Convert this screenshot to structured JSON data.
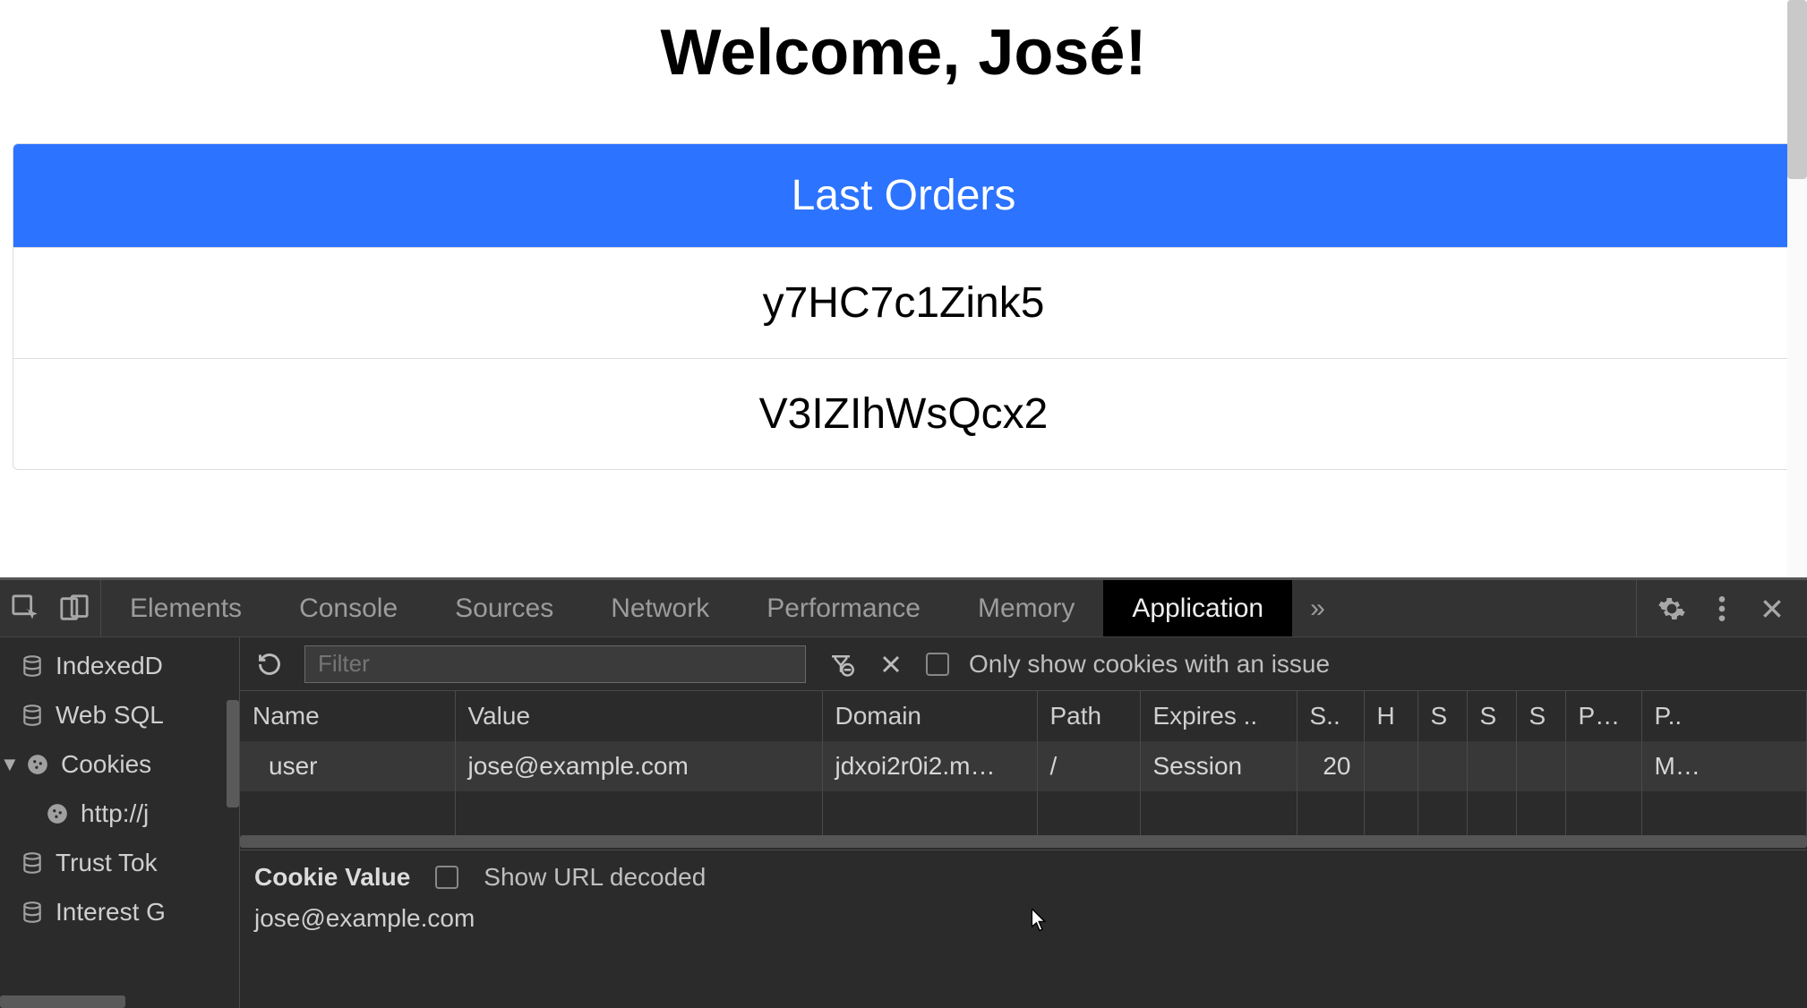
{
  "page": {
    "welcome": "Welcome, José!",
    "last_orders_title": "Last Orders",
    "orders": [
      "y7HC7c1Zink5",
      "V3IZIhWsQcx2"
    ]
  },
  "devtools": {
    "tabs": {
      "elements": "Elements",
      "console": "Console",
      "sources": "Sources",
      "network": "Network",
      "performance": "Performance",
      "memory": "Memory",
      "application": "Application"
    },
    "more": "»",
    "sidebar": {
      "indexeddb": "IndexedD",
      "websql": "Web SQL",
      "cookies": "Cookies",
      "cookies_origin": "http://j",
      "trust_tokens": "Trust Tok",
      "interest_groups": "Interest G"
    },
    "toolbar": {
      "filter_placeholder": "Filter",
      "only_issue": "Only show cookies with an issue"
    },
    "table": {
      "headers": {
        "name": "Name",
        "value": "Value",
        "domain": "Domain",
        "path": "Path",
        "expires": "Expires ..",
        "size": "S..",
        "h": "H",
        "s1": "S",
        "s2": "S",
        "s3": "S",
        "p1": "P…",
        "p2": "P.."
      },
      "rows": [
        {
          "name": "user",
          "value": "jose@example.com",
          "domain": "jdxoi2r0i2.m…",
          "path": "/",
          "expires": "Session",
          "size": "20",
          "h": "",
          "s1": "",
          "s2": "",
          "s3": "",
          "p1": "",
          "p2": "M…"
        }
      ]
    },
    "detail": {
      "label": "Cookie Value",
      "show_url_decoded": "Show URL decoded",
      "value": "jose@example.com"
    }
  }
}
